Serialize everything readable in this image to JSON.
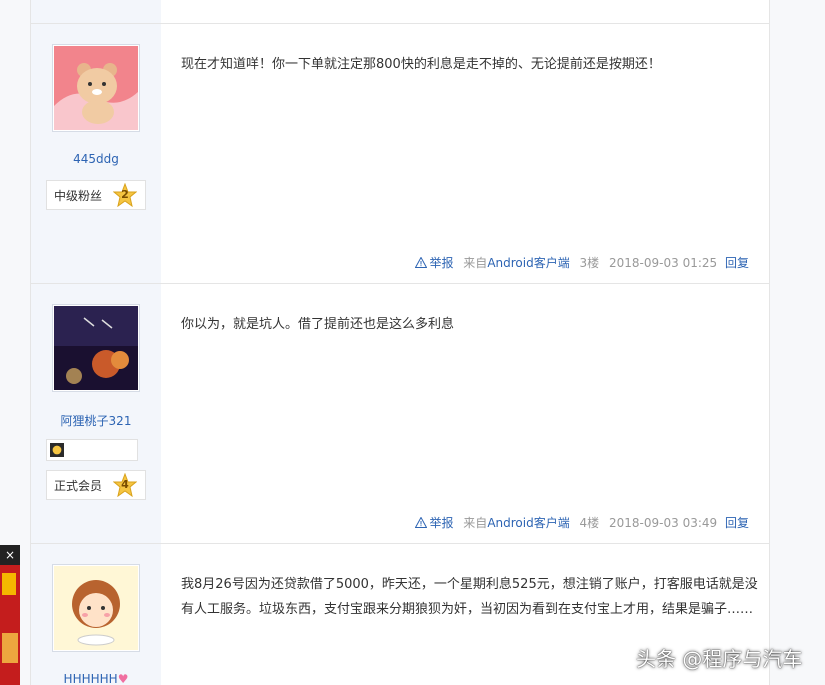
{
  "posts": [
    {
      "username": "445ddg",
      "level_title": "中级粉丝",
      "level_num": "2",
      "content": "现在才知道咩！你一下单就注定那800快的利息是走不掉的、无论提前还是按期还！",
      "report": "举报",
      "source_prefix": "来自",
      "source_client": "Android客户端",
      "floor": "3楼",
      "time": "2018-09-03 01:25",
      "reply": "回复"
    },
    {
      "username": "阿狸桃子321",
      "level_title": "正式会员",
      "level_num": "4",
      "content": "你以为，就是坑人。借了提前还也是这么多利息",
      "report": "举报",
      "source_prefix": "来自",
      "source_client": "Android客户端",
      "floor": "4楼",
      "time": "2018-09-03 03:49",
      "reply": "回复"
    },
    {
      "username": "HHHHHH",
      "content": "我8月26号因为还贷款借了5000，昨天还，一个星期利息525元，想注销了账户，打客服电话就是没有人工服务。垃圾东西，支付宝跟来分期狼狈为奸，当初因为看到在支付宝上才用，结果是骗子……"
    }
  ],
  "ad": {
    "close_label": "×"
  },
  "watermark": "头条 @程序与汽车",
  "colors": {
    "link": "#2d64b3",
    "side_bg": "#f3f6fb",
    "border": "#e5e5e5"
  }
}
